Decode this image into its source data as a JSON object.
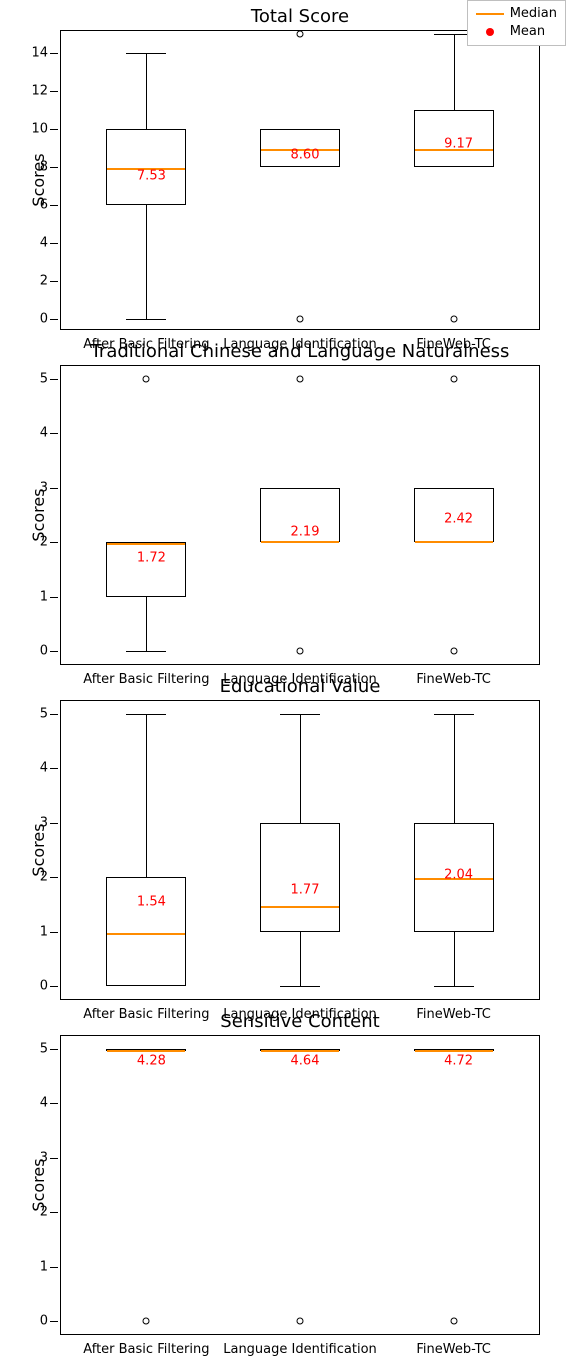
{
  "legend": {
    "median": "Median",
    "mean": "Mean"
  },
  "ylabel": "Scores",
  "categories": [
    "After Basic Filtering",
    "Language Identification",
    "FineWeb-TC"
  ],
  "chart_data": [
    {
      "title": "Total Score",
      "type": "box",
      "ylim": [
        -0.6,
        15.2
      ],
      "yticks": [
        0,
        2,
        4,
        6,
        8,
        10,
        12,
        14
      ],
      "series": [
        {
          "name": "After Basic Filtering",
          "q1": 6.0,
          "median": 8.0,
          "q3": 10.0,
          "whisker_low": 0.0,
          "whisker_high": 14.0,
          "fliers": [],
          "mean": 7.53
        },
        {
          "name": "Language Identification",
          "q1": 8.0,
          "median": 9.0,
          "q3": 10.0,
          "whisker_low": 8.0,
          "whisker_high": 10.0,
          "fliers": [
            0.0,
            15.0
          ],
          "mean": 8.6
        },
        {
          "name": "FineWeb-TC",
          "q1": 8.0,
          "median": 9.0,
          "q3": 11.0,
          "whisker_low": 8.0,
          "whisker_high": 15.0,
          "fliers": [
            0.0
          ],
          "mean": 9.17
        }
      ]
    },
    {
      "title": "Traditional Chinese and Language Naturalness",
      "type": "box",
      "ylim": [
        -0.25,
        5.25
      ],
      "yticks": [
        0,
        1,
        2,
        3,
        4,
        5
      ],
      "series": [
        {
          "name": "After Basic Filtering",
          "q1": 1.0,
          "median": 2.0,
          "q3": 2.0,
          "whisker_low": 0.0,
          "whisker_high": 2.0,
          "fliers": [
            5.0
          ],
          "mean": 1.72
        },
        {
          "name": "Language Identification",
          "q1": 2.0,
          "median": 2.0,
          "q3": 3.0,
          "whisker_low": 2.0,
          "whisker_high": 3.0,
          "fliers": [
            0.0,
            5.0
          ],
          "mean": 2.19
        },
        {
          "name": "FineWeb-TC",
          "q1": 2.0,
          "median": 2.0,
          "q3": 3.0,
          "whisker_low": 2.0,
          "whisker_high": 3.0,
          "fliers": [
            0.0,
            5.0
          ],
          "mean": 2.42
        }
      ]
    },
    {
      "title": "Educational Value",
      "type": "box",
      "ylim": [
        -0.25,
        5.25
      ],
      "yticks": [
        0,
        1,
        2,
        3,
        4,
        5
      ],
      "series": [
        {
          "name": "After Basic Filtering",
          "q1": 0.0,
          "median": 1.0,
          "q3": 2.0,
          "whisker_low": 0.0,
          "whisker_high": 5.0,
          "fliers": [],
          "mean": 1.54
        },
        {
          "name": "Language Identification",
          "q1": 1.0,
          "median": 1.5,
          "q3": 3.0,
          "whisker_low": 0.0,
          "whisker_high": 5.0,
          "fliers": [],
          "mean": 1.77
        },
        {
          "name": "FineWeb-TC",
          "q1": 1.0,
          "median": 2.0,
          "q3": 3.0,
          "whisker_low": 0.0,
          "whisker_high": 5.0,
          "fliers": [],
          "mean": 2.04
        }
      ]
    },
    {
      "title": "Sensitive Content",
      "type": "box",
      "ylim": [
        -0.25,
        5.25
      ],
      "yticks": [
        0,
        1,
        2,
        3,
        4,
        5
      ],
      "series": [
        {
          "name": "After Basic Filtering",
          "q1": 5.0,
          "median": 5.0,
          "q3": 5.0,
          "whisker_low": 5.0,
          "whisker_high": 5.0,
          "fliers": [
            0.0
          ],
          "mean": 4.28
        },
        {
          "name": "Language Identification",
          "q1": 5.0,
          "median": 5.0,
          "q3": 5.0,
          "whisker_low": 5.0,
          "whisker_high": 5.0,
          "fliers": [
            0.0
          ],
          "mean": 4.64
        },
        {
          "name": "FineWeb-TC",
          "q1": 5.0,
          "median": 5.0,
          "q3": 5.0,
          "whisker_low": 5.0,
          "whisker_high": 5.0,
          "fliers": [
            0.0
          ],
          "mean": 4.72
        }
      ]
    }
  ]
}
